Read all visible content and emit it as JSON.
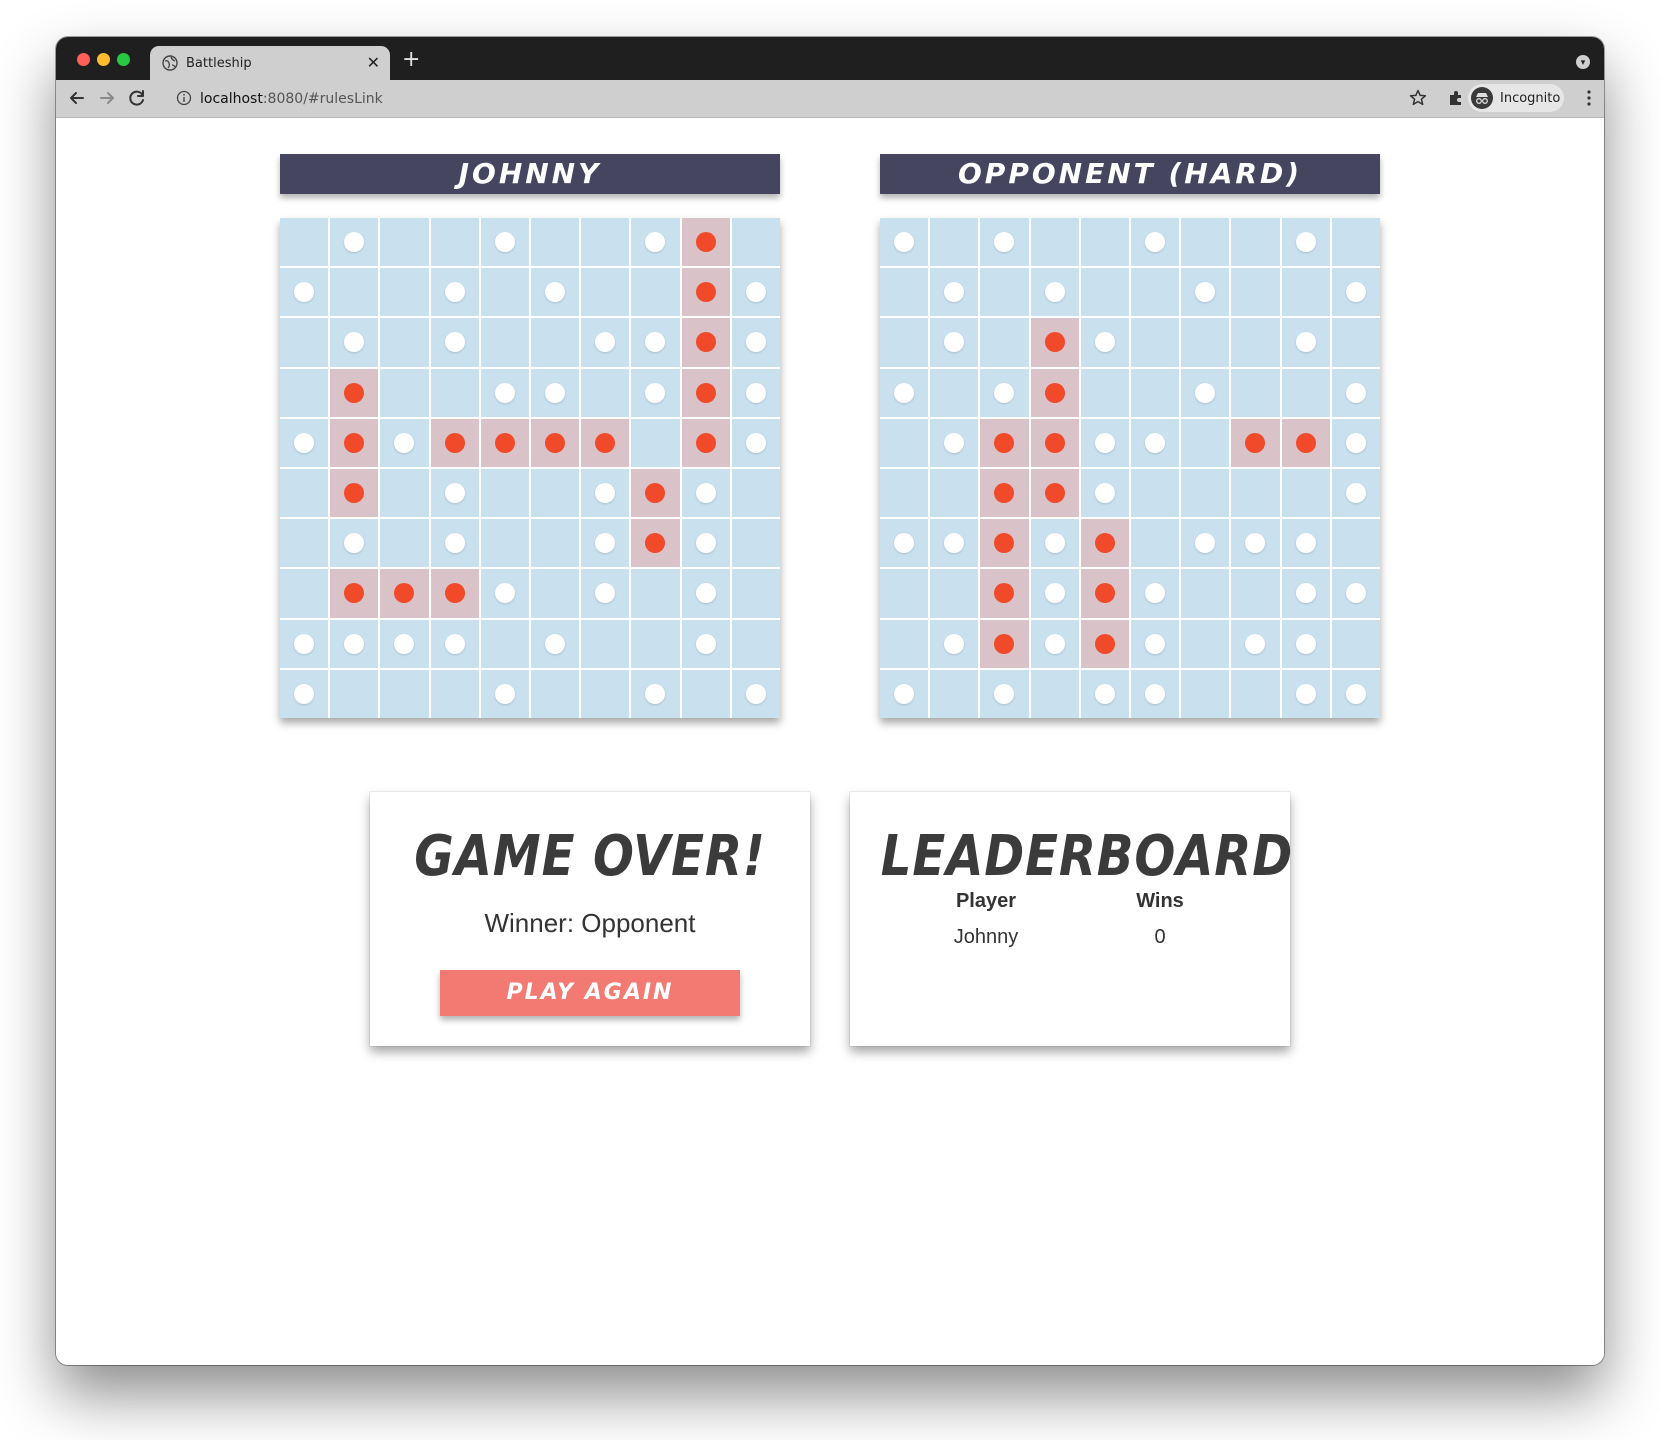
{
  "browser": {
    "tab_title": "Battleship",
    "url_host": "localhost",
    "url_path": ":8080/#rulesLink",
    "incognito_label": "Incognito",
    "new_tab_glyph": "+",
    "close_glyph": "✕"
  },
  "boards": [
    {
      "title": "Johnny",
      "rows": [
        "_o__o__oX_",
        "o__o_o__Xo",
        "_o_o__ooXo",
        "_X__oo_oXo",
        "oXoXXXX_Xo",
        "_X_o__oXo_",
        "_o_o__oXo_",
        "_XXXo_o_o_",
        "oooo_o__o_",
        "o___o__o_o"
      ]
    },
    {
      "title": "Opponent (Hard)",
      "rows": [
        "o_o__o__o_",
        "_o_o__o__o",
        "_o_Xo___o_",
        "o_oX__o__o",
        "_oXXoo_XXo",
        "__XXo____o",
        "ooXoX_ooo_",
        "__XoXo__oo",
        "_oXoXo_oo_",
        "o_o_oo__oo"
      ]
    }
  ],
  "game_over": {
    "title": "Game Over!",
    "winner_text": "Winner: Opponent",
    "play_again_label": "Play Again"
  },
  "leaderboard": {
    "title": "Leaderboard",
    "headers": [
      "Player",
      "Wins"
    ],
    "rows": [
      {
        "player": "Johnny",
        "wins": "0"
      }
    ]
  }
}
